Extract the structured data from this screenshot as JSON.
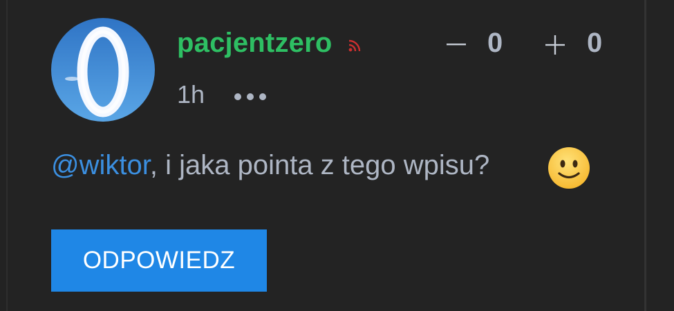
{
  "post": {
    "username": "pacjentzero",
    "time": "1h",
    "votes": {
      "minus_count": "0",
      "plus_count": "0"
    },
    "comment": {
      "mention": "@wiktor",
      "text": ", i jaka pointa z tego wpisu?",
      "emoji": "slightly-smiling-face"
    },
    "reply_label": "ODPOWIEDZ"
  },
  "icons": {
    "rss": "rss-icon",
    "minus": "minus-icon",
    "plus": "plus-icon",
    "more": "more-options-icon"
  },
  "colors": {
    "background": "#232323",
    "username": "#2ebf63",
    "text": "#aeb6c4",
    "mention": "#3b8fe0",
    "button": "#1f87e6",
    "rss": "#cc2f2f"
  }
}
